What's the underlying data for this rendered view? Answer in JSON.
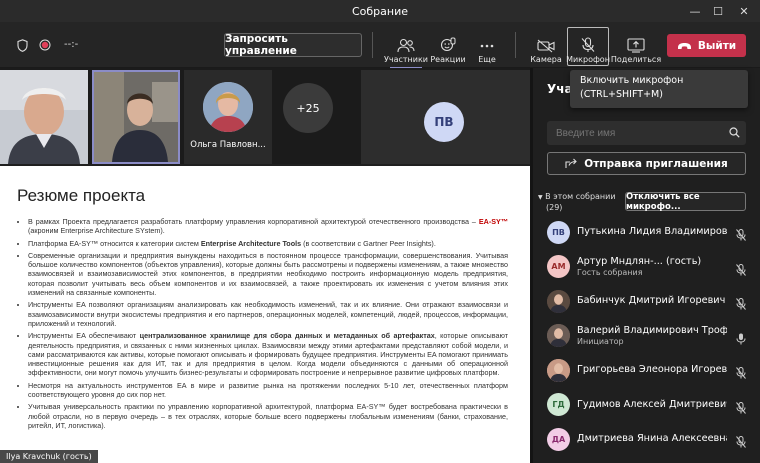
{
  "window": {
    "title": "Собрание",
    "minimize": "—",
    "maximize": "☐",
    "close": "✕"
  },
  "toolbar": {
    "timer": "--:-",
    "request_control": "Запросить управление",
    "participants": "Участники",
    "reactions": "Реакции",
    "more": "Еще",
    "camera": "Камера",
    "mic": "Микрофон",
    "share": "Поделиться",
    "leave": "Выйти"
  },
  "tooltip": {
    "line1": "Включить микрофон",
    "line2": "(CTRL+SHIFT+M)"
  },
  "videos": {
    "person3_name": "Ольга Павловн...",
    "overflow": "+25",
    "initials": "ПВ"
  },
  "slide": {
    "title": "Резюме проекта",
    "bullets": [
      {
        "pre": "В рамках Проекта предлагается разработать платформу управления корпоративной архитектурой отечественного производства – ",
        "red": "EA-SY™",
        "post": " (акроним Enterprise Architecture SYstem)."
      },
      {
        "pre": "Платформа EA-SY™ относится к категории систем ",
        "bold": "Enterprise Architecture Tools",
        "post": " (в соответствии с Gartner Peer Insights)."
      },
      {
        "pre": "Современные организации и предприятия вынуждены находиться в постоянном процессе трансформации, совершенствования. Учитывая большое количество компонентов (объектов управления), которые должны быть рассмотрены и подвержены изменениям, а также множество взаимосвязей и взаимозависимостей этих компонентов, в предприятии необходимо построить информационную модель предприятия, которая позволит учитывать весь объем компонентов и их взаимосвязей, а также проектировать их изменения с учетом влияния этих изменений на связанные компоненты."
      },
      {
        "pre": "Инструменты EA позволяют организациям анализировать как необходимость изменений, так и их влияние. Они отражают взаимосвязи и взаимозависимости внутри экосистемы предприятия и его партнеров, операционных моделей, компетенций, людей, процессов, информации, приложений и технологий."
      },
      {
        "pre": "Инструменты EA обеспечивают ",
        "bold": "централизованное хранилище для сбора данных и метаданных об артефактах",
        "post": ", которые описывают деятельность предприятия, и связанных с ними жизненных циклах. Взаимосвязи между этими артефактами представляют собой модели, и сами рассматриваются как активы, которые помогают описывать и формировать будущее предприятия. Инструменты EA помогают принимать инвестиционные решения как для ИТ, так и для предприятия в целом. Когда модели объединяются с данными об операционной эффективности, они могут помочь улучшить бизнес-результаты и сформировать построение и непрерывное развитие цифровых платформ."
      },
      {
        "pre": "Несмотря на актуальность инструментов EA в мире и развитие рынка на протяжении последних 5-10 лет, отечественных платформ соответствующего уровня до сих пор нет."
      },
      {
        "pre": "Учитывая универсальность практики по управлению корпоративной архитектурой, платформа EA-SY™ будет востребована практически в любой отрасли, но в первую очередь – в тех отраслях, которые больше всего подвержены глобальным изменениям (банки, страхование, ритейл, ИТ, логистика)."
      }
    ]
  },
  "presenter_label": "Ilya Kravchuk (гость)",
  "panel": {
    "title": "Учас",
    "search_placeholder": "Введите имя",
    "invite": "Отправка приглашения",
    "section_line1": "В этом собрании",
    "section_line2": "(29)",
    "mute_all": "Отключить все микрофо...",
    "people": [
      {
        "initials": "ПВ",
        "name": "Путькина Лидия Владимировна",
        "sub": "",
        "color": "#cfd8f5",
        "fg": "#34407a"
      },
      {
        "initials": "АМ",
        "name": "Артур Мндлян-...  (гость)",
        "sub": "Гость собрания",
        "color": "#f4c6c6",
        "fg": "#9a2c2c"
      },
      {
        "initials": "",
        "name": "Бабинчук Дмитрий Игоревич",
        "sub": "",
        "color": "#5a4a40",
        "fg": "#fff"
      },
      {
        "initials": "",
        "name": "Валерий Владимирович Трофи...",
        "sub": "Инициатор",
        "color": "#6b5c55",
        "fg": "#fff"
      },
      {
        "initials": "",
        "name": "Григорьева Элеонора Игоревна",
        "sub": "",
        "color": "#c89a86",
        "fg": "#fff"
      },
      {
        "initials": "ГД",
        "name": "Гудимов Алексей Дмитриевич",
        "sub": "",
        "color": "#cfe8d4",
        "fg": "#2d6b3b"
      },
      {
        "initials": "ДА",
        "name": "Дмитриева Янина Алексеевна",
        "sub": "",
        "color": "#f2cde6",
        "fg": "#8a2a6e"
      }
    ]
  }
}
